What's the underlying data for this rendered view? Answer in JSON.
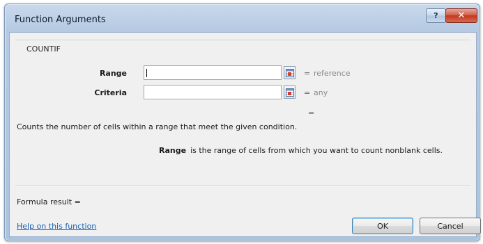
{
  "window": {
    "title": "Function Arguments",
    "help_label": "?",
    "close_label": "✕"
  },
  "function_name": "COUNTIF",
  "arguments": [
    {
      "label": "Range",
      "value": "",
      "equals": "=",
      "hint": "reference"
    },
    {
      "label": "Criteria",
      "value": "",
      "equals": "=",
      "hint": "any"
    }
  ],
  "result_equals": "=",
  "description": "Counts the number of cells within a range that meet the given condition.",
  "argument_help": {
    "name": "Range",
    "text": "is the range of cells from which you want to count nonblank cells."
  },
  "formula_result_label": "Formula result =",
  "help_link": "Help on this function",
  "buttons": {
    "ok": "OK",
    "cancel": "Cancel"
  },
  "icons": {
    "help": "question-icon",
    "close": "close-icon",
    "collapse": "collapse-dialog-icon"
  }
}
